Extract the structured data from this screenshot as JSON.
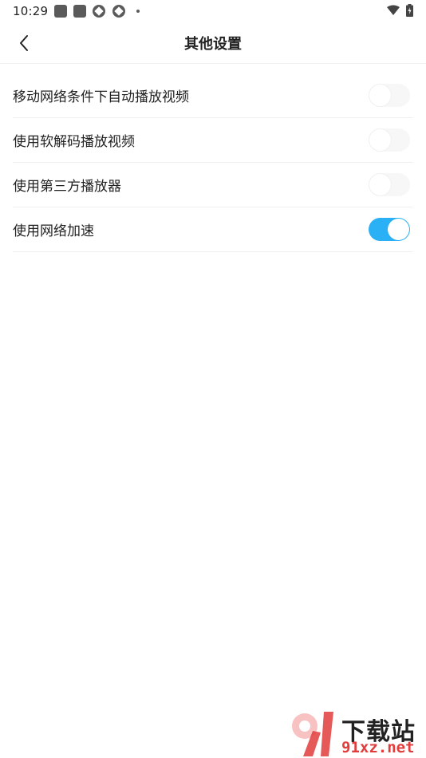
{
  "status_bar": {
    "time": "10:29",
    "notification_icons": [
      "app-icon",
      "app-icon",
      "pinwheel-icon",
      "pinwheel-icon"
    ],
    "wifi_icon": "wifi-icon",
    "battery_icon": "battery-charging-icon"
  },
  "nav": {
    "back_icon": "chevron-left-icon",
    "title": "其他设置"
  },
  "settings": [
    {
      "label": "移动网络条件下自动播放视频",
      "enabled": false
    },
    {
      "label": "使用软解码播放视频",
      "enabled": false
    },
    {
      "label": "使用第三方播放器",
      "enabled": false
    },
    {
      "label": "使用网络加速",
      "enabled": true
    }
  ],
  "watermark": {
    "title": "下载站",
    "domain": "91xz.net"
  },
  "colors": {
    "toggle_on": "#2ab0f4",
    "toggle_off": "#f7f7f7",
    "watermark_red": "#e23c3c"
  }
}
